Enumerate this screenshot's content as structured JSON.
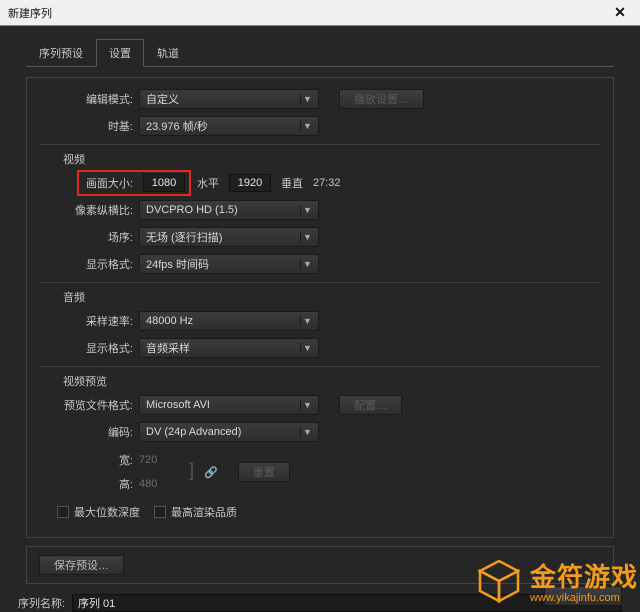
{
  "window": {
    "title": "新建序列",
    "close": "✕"
  },
  "tabs": {
    "preset": "序列预设",
    "settings": "设置",
    "tracks": "轨道"
  },
  "form": {
    "edit_mode_label": "编辑模式:",
    "edit_mode_value": "自定义",
    "playback_settings_btn": "播放设置…",
    "timebase_label": "时基:",
    "timebase_value": "23.976 帧/秒",
    "video_section": "视频",
    "frame_size_label": "画面大小:",
    "frame_w": "1080",
    "horiz_label": "水平",
    "frame_h": "1920",
    "vert_label": "垂直",
    "aspect_display": "27:32",
    "par_label": "像素纵横比:",
    "par_value": "DVCPRO HD (1.5)",
    "fields_label": "场序:",
    "fields_value": "无场 (逐行扫描)",
    "vdisplay_label": "显示格式:",
    "vdisplay_value": "24fps 时间码",
    "audio_section": "音频",
    "sample_rate_label": "采样速率:",
    "sample_rate_value": "48000 Hz",
    "adisplay_label": "显示格式:",
    "adisplay_value": "音频采样",
    "preview_section": "视频预览",
    "preview_format_label": "预览文件格式:",
    "preview_format_value": "Microsoft AVI",
    "configure_btn": "配置…",
    "codec_label": "编码:",
    "codec_value": "DV (24p Advanced)",
    "width_label": "宽:",
    "width_value": "720",
    "height_label": "高:",
    "height_value": "480",
    "reset_btn": "重置",
    "max_bitdepth_label": "最大位数深度",
    "max_quality_label": "最高渲染品质",
    "save_preset_btn": "保存预设…",
    "seq_name_label": "序列名称:",
    "seq_name_value": "序列 01"
  },
  "logo": {
    "brand": "金符游戏",
    "url": "www.yikajinfu.com"
  }
}
